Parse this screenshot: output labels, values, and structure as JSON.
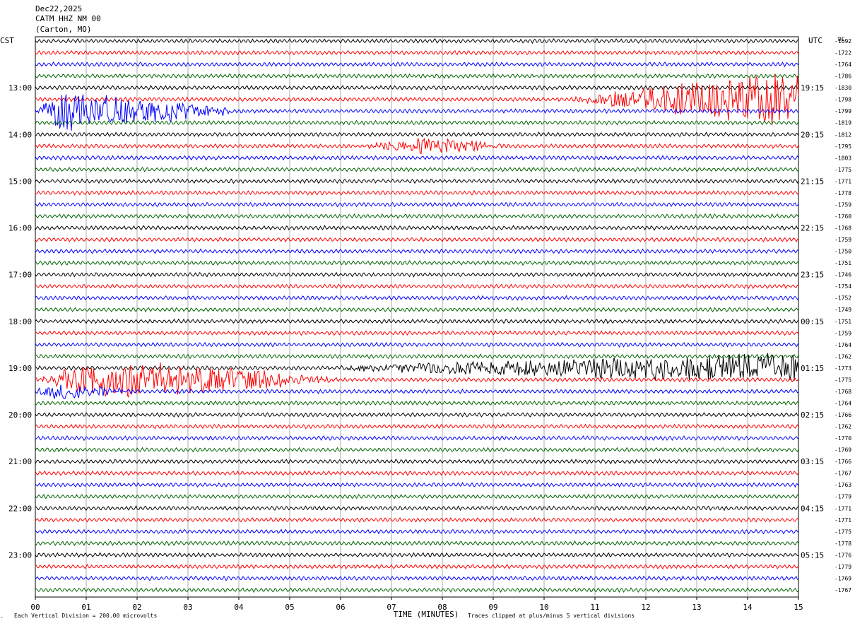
{
  "header": {
    "date": "Dec22,2025",
    "station": "CATM HHZ NM 00",
    "location": "(Carton, MO)"
  },
  "left_zone": "CST",
  "right_zone": "UTC",
  "dc_header": "DC",
  "footer": {
    "vertical_division": "Each Vertical Division =  200.00 microvolts",
    "clip_note": "Traces clipped at plus/minus 5 vertical divisions",
    "xaxis_title": "TIME (MINUTES)"
  },
  "colors": {
    "cycle": [
      "#000000",
      "#ff0000",
      "#0000ff",
      "#006400"
    ],
    "grid": "#999999"
  },
  "chart_data": {
    "type": "line",
    "title": "",
    "xlabel": "TIME (MINUTES)",
    "ylabel": "",
    "xlim": [
      0,
      15
    ],
    "x_ticks": [
      "00",
      "01",
      "02",
      "03",
      "04",
      "05",
      "06",
      "07",
      "08",
      "09",
      "10",
      "11",
      "12",
      "13",
      "14",
      "15"
    ],
    "rows_per_hour": 4,
    "row_minutes": 15,
    "left_hour_labels": [
      "13:00",
      "14:00",
      "15:00",
      "16:00",
      "17:00",
      "18:00",
      "19:00",
      "20:00",
      "21:00",
      "22:00",
      "23:00"
    ],
    "right_hour_labels": [
      "19:15",
      "20:15",
      "21:15",
      "22:15",
      "23:15",
      "00:15",
      "01:15",
      "02:15",
      "03:15",
      "04:15",
      "05:15"
    ],
    "dc_offsets": [
      "-1692",
      "-1722",
      "-1764",
      "-1786",
      "-1830",
      "-1798",
      "-1799",
      "-1819",
      "-1812",
      "-1795",
      "-1803",
      "-1775",
      "-1771",
      "-1778",
      "-1759",
      "-1760",
      "-1768",
      "-1759",
      "-1750",
      "-1751",
      "-1746",
      "-1754",
      "-1752",
      "-1749",
      "-1751",
      "-1759",
      "-1764",
      "-1762",
      "-1773",
      "-1775",
      "-1768",
      "-1764",
      "-1766",
      "-1762",
      "-1770",
      "-1769",
      "-1766",
      "-1767",
      "-1763",
      "-1779",
      "-1771",
      "-1771",
      "-1775",
      "-1778",
      "-1776",
      "-1779",
      "-1769",
      "-1767"
    ],
    "events": [
      {
        "row": 5,
        "start_min": 10.5,
        "peak_min": 15.0,
        "end_min": 15.0,
        "amplitude": 4.2
      },
      {
        "row": 6,
        "start_min": 0.0,
        "peak_min": 0.5,
        "end_min": 4.0,
        "amplitude": 3.0
      },
      {
        "row": 9,
        "start_min": 6.5,
        "peak_min": 7.8,
        "end_min": 9.3,
        "amplitude": 1.3
      },
      {
        "row": 28,
        "start_min": 5.5,
        "peak_min": 15.0,
        "end_min": 15.0,
        "amplitude": 2.2
      },
      {
        "row": 29,
        "start_min": 0.0,
        "peak_min": 1.5,
        "end_min": 6.0,
        "amplitude": 3.0
      },
      {
        "row": 30,
        "start_min": 0.0,
        "peak_min": 0.4,
        "end_min": 2.0,
        "amplitude": 1.1
      }
    ]
  }
}
